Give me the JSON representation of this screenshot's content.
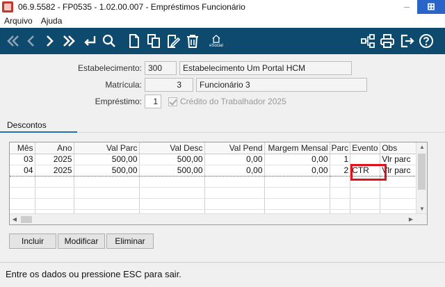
{
  "window": {
    "title": "06.9.5582 - FP0535 - 1.02.00.007 - Empréstimos Funcionário",
    "minimize_glyph": "–",
    "corner_glyph": "⊞"
  },
  "menubar": {
    "items": [
      "Arquivo",
      "Ajuda"
    ]
  },
  "toolbar": {
    "esocial_label": "eSocial",
    "accent_color": "#0e4a6e"
  },
  "form": {
    "estabelecimento": {
      "label": "Estabelecimento:",
      "code": "300",
      "description": "Estabelecimento Um Portal HCM"
    },
    "matricula": {
      "label": "Matrícula:",
      "value": "3",
      "description": "Funcionário 3"
    },
    "emprestimo": {
      "label": "Empréstimo:",
      "value": "1",
      "checkbox_label": "Crédito do Trabalhador 2025",
      "checked": true
    }
  },
  "tabs": [
    {
      "label": "Descontos",
      "active": true
    }
  ],
  "grid": {
    "columns": [
      "Mês",
      "Ano",
      "Val Parc",
      "Val Desc",
      "Val Pend",
      "Margem Mensal",
      "Parc",
      "Evento",
      "Obs"
    ],
    "rows": [
      [
        "03",
        "2025",
        "500,00",
        "500,00",
        "0,00",
        "0,00",
        "1",
        "",
        "Vlr parc"
      ],
      [
        "04",
        "2025",
        "500,00",
        "500,00",
        "0,00",
        "0,00",
        "2",
        "CTR",
        "Vlr parc"
      ]
    ],
    "selected_row": 1,
    "highlight_color": "#e2101a"
  },
  "buttons": {
    "incluir": "Incluir",
    "modificar": "Modificar",
    "eliminar": "Eliminar"
  },
  "status": {
    "message": "Entre os dados ou pressione ESC para sair."
  }
}
